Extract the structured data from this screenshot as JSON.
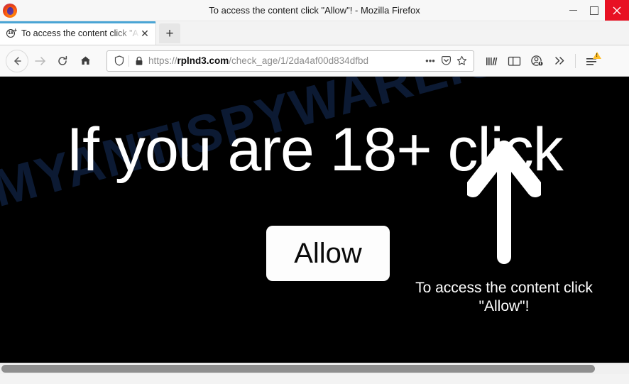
{
  "window": {
    "title": "To access the content click \"Allow\"! - Mozilla Firefox",
    "logo_icon": "firefox-logo",
    "minimize_label": "",
    "maximize_label": "",
    "close_label": "✕"
  },
  "tabs": {
    "active": {
      "favicon_text": "18",
      "favicon_plus": "+",
      "title": "To access the content click \"Allow\"! - Mozilla Firefox",
      "close_label": "✕"
    },
    "new_tab_label": "+"
  },
  "toolbar": {
    "back_label": "←",
    "forward_label": "→",
    "reload_label": "⟳",
    "home_label": "⌂",
    "menu_more_label": "»",
    "page_actions_label": "•••"
  },
  "urlbar": {
    "protocol": "https://",
    "host": "rplnd3.com",
    "path": "/check_age/1/2da4af00d834dfbd",
    "full_url": "https://rplnd3.com/check_age/1/2da4af00d834dfbd"
  },
  "page": {
    "background_color": "#000000",
    "watermark": "MYANTISPYWARE.COM",
    "watermark_color": "#0c1a33",
    "headline": "If you are 18+ click",
    "allow_button_label": "Allow",
    "note_line1": "To access the content click",
    "note_line2": "\"Allow\"!",
    "arrow_icon": "up-arrow",
    "arrow_color": "#ffffff",
    "text_color": "#ffffff"
  },
  "scrollbar": {
    "orientation": "horizontal",
    "thumb_color": "#8f8f8f"
  }
}
